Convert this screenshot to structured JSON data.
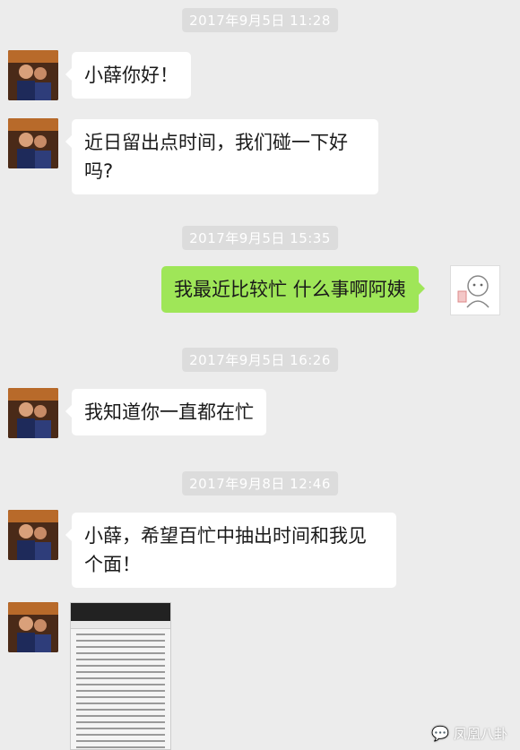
{
  "messages": [
    {
      "type": "timestamp",
      "text": "2017年9月5日 11:28"
    },
    {
      "type": "incoming",
      "text": "小薛你好！"
    },
    {
      "type": "incoming",
      "text": "近日留出点时间，我们碰一下好吗?"
    },
    {
      "type": "timestamp",
      "text": "2017年9月5日 15:35"
    },
    {
      "type": "outgoing",
      "text": "我最近比较忙 什么事啊阿姨"
    },
    {
      "type": "timestamp",
      "text": "2017年9月5日 16:26"
    },
    {
      "type": "incoming",
      "text": "我知道你一直都在忙"
    },
    {
      "type": "timestamp",
      "text": "2017年9月8日 12:46"
    },
    {
      "type": "incoming",
      "text": "小薛，希望百忙中抽出时间和我见个面！"
    }
  ],
  "watermark": {
    "icon": "wechat-icon",
    "text": "凤凰八卦"
  },
  "colors": {
    "background": "#ececec",
    "outgoing_bubble": "#9fe658",
    "incoming_bubble": "#ffffff"
  }
}
